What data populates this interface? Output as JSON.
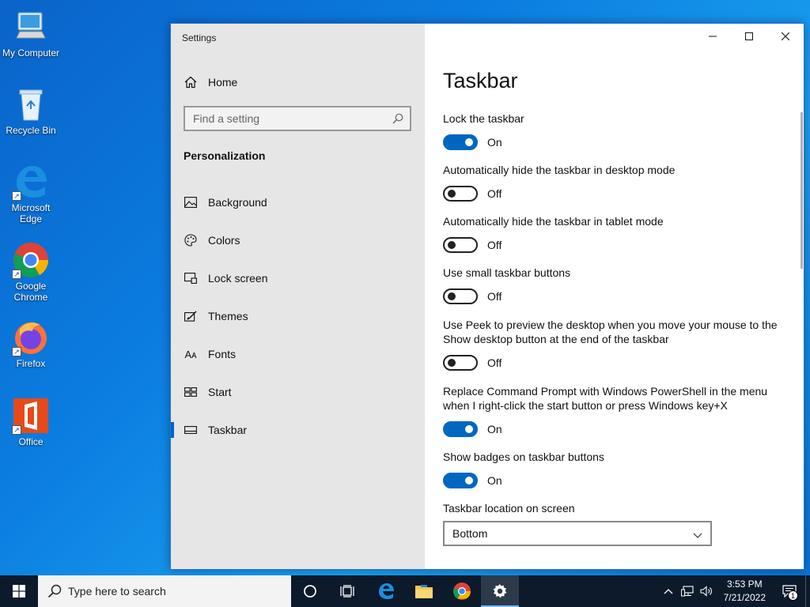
{
  "desktop": {
    "icons": [
      {
        "label": "My Computer"
      },
      {
        "label": "Recycle Bin"
      },
      {
        "label": "Microsoft Edge"
      },
      {
        "label": "Google Chrome"
      },
      {
        "label": "Firefox"
      },
      {
        "label": "Office"
      }
    ]
  },
  "window": {
    "title": "Settings",
    "nav": {
      "home_label": "Home",
      "search_placeholder": "Find a setting",
      "section_title": "Personalization",
      "items": [
        {
          "label": "Background",
          "icon": "picture-icon"
        },
        {
          "label": "Colors",
          "icon": "palette-icon"
        },
        {
          "label": "Lock screen",
          "icon": "lock-screen-icon"
        },
        {
          "label": "Themes",
          "icon": "themes-icon"
        },
        {
          "label": "Fonts",
          "icon": "fonts-icon"
        },
        {
          "label": "Start",
          "icon": "start-icon"
        },
        {
          "label": "Taskbar",
          "icon": "taskbar-icon",
          "active": true
        }
      ],
      "fonts_glyph": "Aᴀ"
    },
    "content": {
      "title": "Taskbar",
      "settings": [
        {
          "label": "Lock the taskbar",
          "state": "On"
        },
        {
          "label": "Automatically hide the taskbar in desktop mode",
          "state": "Off"
        },
        {
          "label": "Automatically hide the taskbar in tablet mode",
          "state": "Off"
        },
        {
          "label": "Use small taskbar buttons",
          "state": "Off"
        },
        {
          "label": "Use Peek to preview the desktop when you move your mouse to the Show desktop button at the end of the taskbar",
          "state": "Off"
        },
        {
          "label": "Replace Command Prompt with Windows PowerShell in the menu when I right-click the start button or press Windows key+X",
          "state": "On"
        },
        {
          "label": "Show badges on taskbar buttons",
          "state": "On"
        }
      ],
      "location": {
        "label": "Taskbar location on screen",
        "value": "Bottom"
      }
    }
  },
  "taskbar": {
    "search_placeholder": "Type here to search",
    "clock_time": "3:53 PM",
    "clock_date": "7/21/2022",
    "notification_count": "1",
    "accent": "#0067c0"
  }
}
